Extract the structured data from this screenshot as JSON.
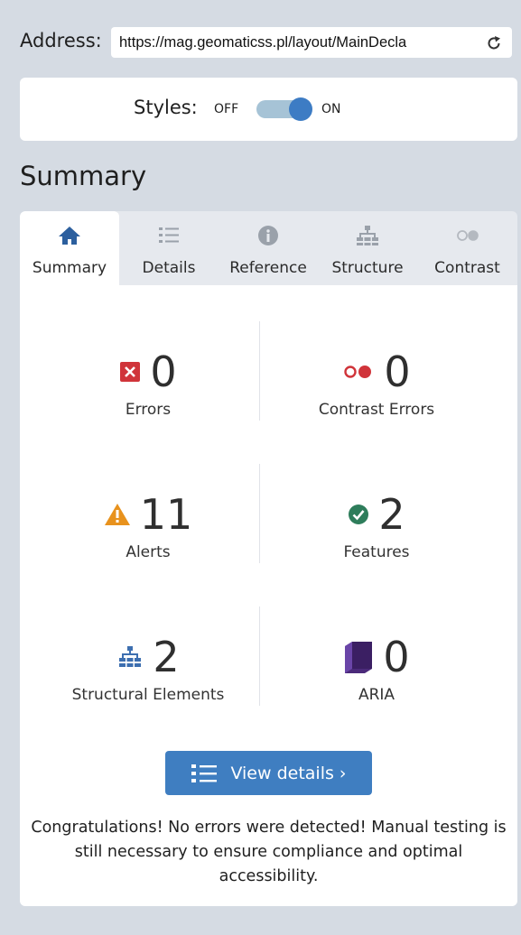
{
  "address": {
    "label": "Address:",
    "url": "https://mag.geomaticss.pl/layout/MainDecla"
  },
  "styles_toggle": {
    "label": "Styles:",
    "off_label": "OFF",
    "on_label": "ON",
    "state": "on"
  },
  "section_title": "Summary",
  "tabs": [
    {
      "label": "Summary",
      "icon": "home-icon",
      "active": true
    },
    {
      "label": "Details",
      "icon": "list-icon",
      "active": false
    },
    {
      "label": "Reference",
      "icon": "info-icon",
      "active": false
    },
    {
      "label": "Structure",
      "icon": "hierarchy-icon",
      "active": false
    },
    {
      "label": "Contrast",
      "icon": "contrast-icon",
      "active": false
    }
  ],
  "stats": {
    "errors": {
      "value": "0",
      "label": "Errors",
      "icon": "error-icon"
    },
    "contrast_errors": {
      "value": "0",
      "label": "Contrast Errors",
      "icon": "contrast-error-icon"
    },
    "alerts": {
      "value": "11",
      "label": "Alerts",
      "icon": "alert-icon"
    },
    "features": {
      "value": "2",
      "label": "Features",
      "icon": "feature-check-icon"
    },
    "structural": {
      "value": "2",
      "label": "Structural Elements",
      "icon": "structure-icon"
    },
    "aria": {
      "value": "0",
      "label": "ARIA",
      "icon": "aria-cube-icon"
    }
  },
  "view_details_label": "View details ›",
  "congrats_text": "Congratulations! No errors were detected! Manual testing is still necessary to ensure compliance and optimal accessibility.",
  "colors": {
    "background": "#d5dbe3",
    "accent": "#3f7ec1",
    "error": "#d0343a",
    "alert": "#e8921d",
    "feature": "#2e7d5b",
    "aria": "#4b2a7a"
  }
}
